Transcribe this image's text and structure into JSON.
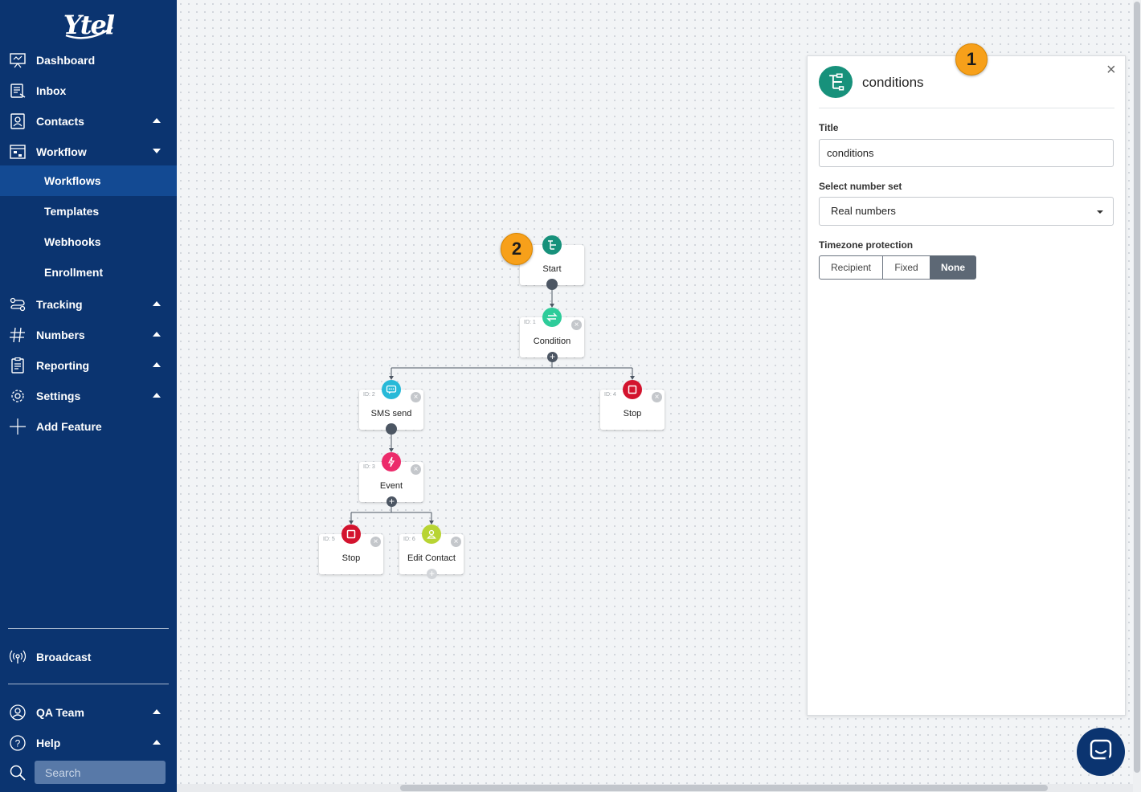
{
  "brand": {
    "logo_text": "Ytel"
  },
  "sidebar": {
    "items": [
      {
        "label": "Dashboard",
        "icon": "dashboard-icon"
      },
      {
        "label": "Inbox",
        "icon": "inbox-icon"
      },
      {
        "label": "Contacts",
        "icon": "contacts-icon",
        "caret": "up"
      },
      {
        "label": "Workflow",
        "icon": "workflow-icon",
        "caret": "down"
      },
      {
        "label": "Tracking",
        "icon": "tracking-icon",
        "caret": "up"
      },
      {
        "label": "Numbers",
        "icon": "hash-icon",
        "caret": "up"
      },
      {
        "label": "Reporting",
        "icon": "reporting-icon",
        "caret": "up"
      },
      {
        "label": "Settings",
        "icon": "gear-icon",
        "caret": "up"
      },
      {
        "label": "Add Feature",
        "icon": "plus-icon"
      }
    ],
    "workflow_sub": [
      "Workflows",
      "Templates",
      "Webhooks",
      "Enrollment"
    ],
    "active_sub": "Workflows",
    "broadcast": "Broadcast",
    "team": "QA Team",
    "help": "Help",
    "search_placeholder": "Search"
  },
  "flow": {
    "nodes": [
      {
        "key": "start",
        "label": "Start",
        "id_label": "",
        "icon": "branch-icon",
        "icon_color": "#17917b"
      },
      {
        "key": "condition",
        "label": "Condition",
        "id_label": "ID: 1",
        "icon": "swap-icon",
        "icon_color": "#2ecc9a"
      },
      {
        "key": "sms",
        "label": "SMS send",
        "id_label": "ID: 2",
        "icon": "chat-bubble-icon",
        "icon_color": "#27b9d8"
      },
      {
        "key": "stop4",
        "label": "Stop",
        "id_label": "ID: 4",
        "icon": "stop-icon",
        "icon_color": "#d3132e"
      },
      {
        "key": "event",
        "label": "Event",
        "id_label": "ID: 3",
        "icon": "lightning-icon",
        "icon_color": "#ec2b6b"
      },
      {
        "key": "stop5",
        "label": "Stop",
        "id_label": "ID: 5",
        "icon": "stop-icon",
        "icon_color": "#d3132e"
      },
      {
        "key": "edit",
        "label": "Edit Contact",
        "id_label": "ID: 6",
        "icon": "person-icon",
        "icon_color": "#b8d433"
      }
    ],
    "plus_symbol": "+",
    "close_symbol": "×"
  },
  "annotations": {
    "badge_1": "1",
    "badge_2": "2"
  },
  "panel": {
    "title": "conditions",
    "close_symbol": "×",
    "title_label": "Title",
    "title_value": "conditions",
    "number_set_label": "Select number set",
    "number_set_value": "Real numbers",
    "timezone_label": "Timezone protection",
    "timezone_options": [
      "Recipient",
      "Fixed",
      "None"
    ],
    "timezone_selected": "None"
  },
  "colors": {
    "sidebar_bg": "#0b3470",
    "active_sub_bg": "#134a93",
    "badge": "#f7a01a",
    "panel_icon": "#17917b"
  }
}
